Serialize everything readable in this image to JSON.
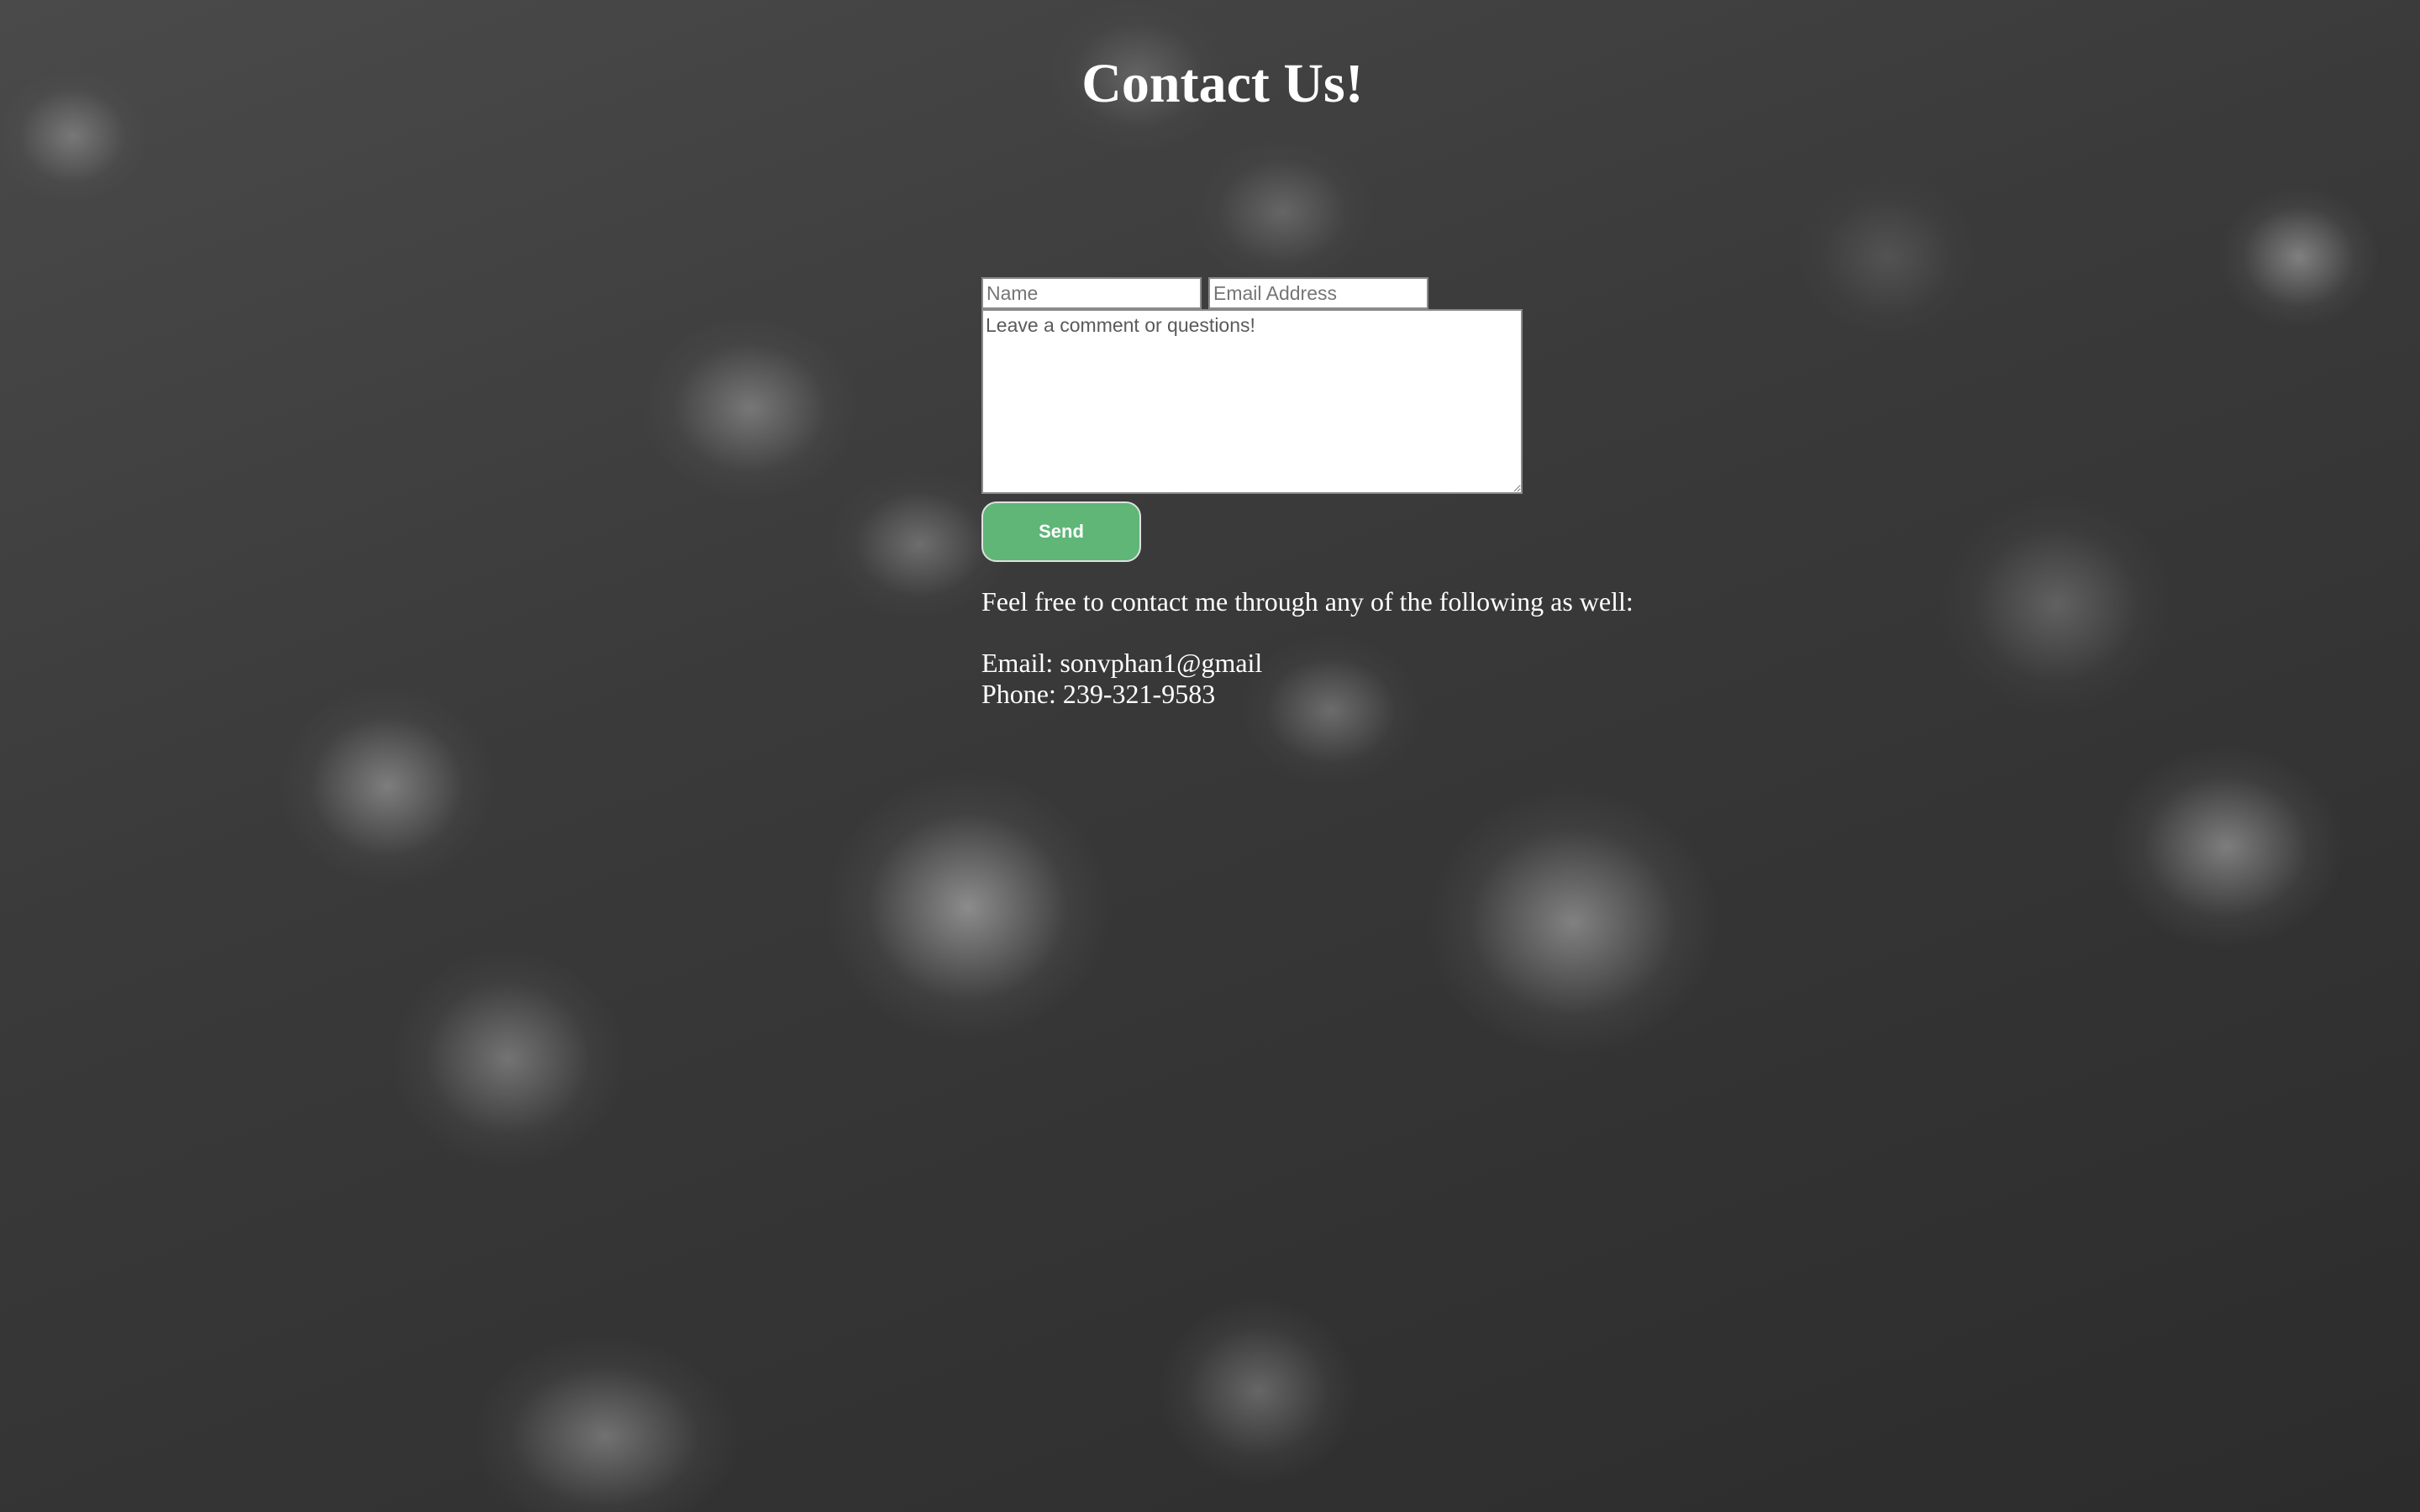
{
  "page": {
    "title": "Contact Us!"
  },
  "form": {
    "name_placeholder": "Name",
    "email_placeholder": "Email Address",
    "comment_placeholder": "Leave a comment or questions!",
    "send_label": "Send"
  },
  "contact_info": {
    "intro": "Feel free to contact me through any of the following as well:",
    "email_line": "Email: sonvphan1@gmail",
    "phone_line": "Phone: 239-321-9583"
  },
  "colors": {
    "send_button": "#5fb677",
    "text": "#ffffff"
  }
}
